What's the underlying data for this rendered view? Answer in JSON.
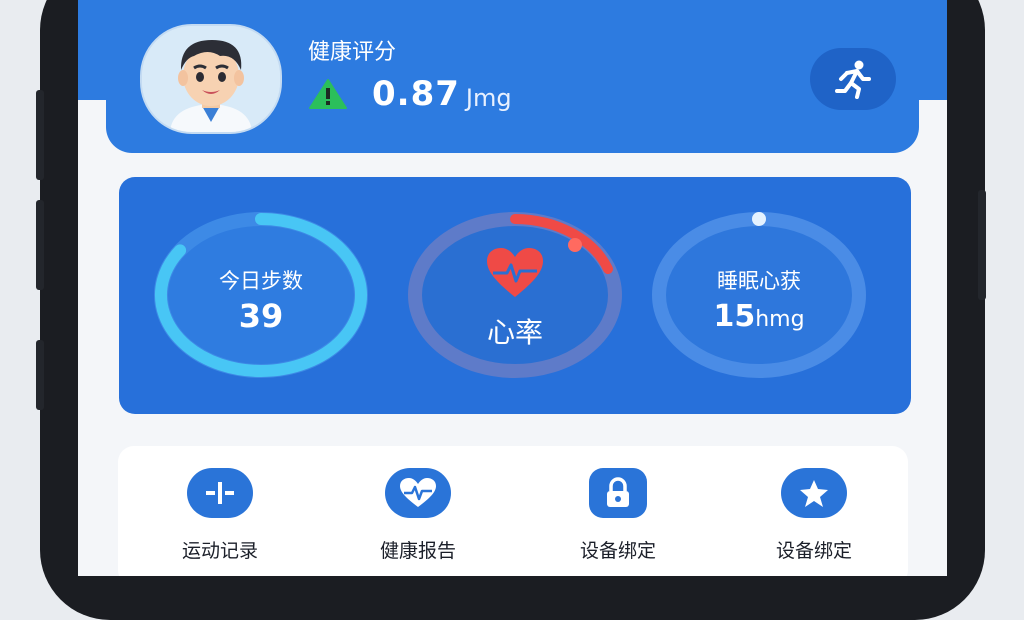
{
  "header": {
    "title": "健康评分",
    "score_value": "0.87",
    "score_unit": "Jmg"
  },
  "stats": {
    "steps": {
      "label": "今日步数",
      "value": "39",
      "progress": 0.85
    },
    "heart": {
      "label": "心率",
      "progress": 0.2
    },
    "sleep": {
      "label": "睡眠心获",
      "value": "15",
      "unit": "hmg"
    }
  },
  "actions": [
    {
      "label": "运动记录",
      "icon": "record-icon"
    },
    {
      "label": "健康报告",
      "icon": "heart-pulse-icon"
    },
    {
      "label": "设备绑定",
      "icon": "lock-icon"
    },
    {
      "label": "设备绑定",
      "icon": "star-icon"
    }
  ],
  "colors": {
    "header_blue": "#2d7be0",
    "card_blue": "#2770da",
    "ring_cyan": "#48c6f5",
    "ring_red": "#ef4a46",
    "warning_green": "#2bbf5b"
  }
}
